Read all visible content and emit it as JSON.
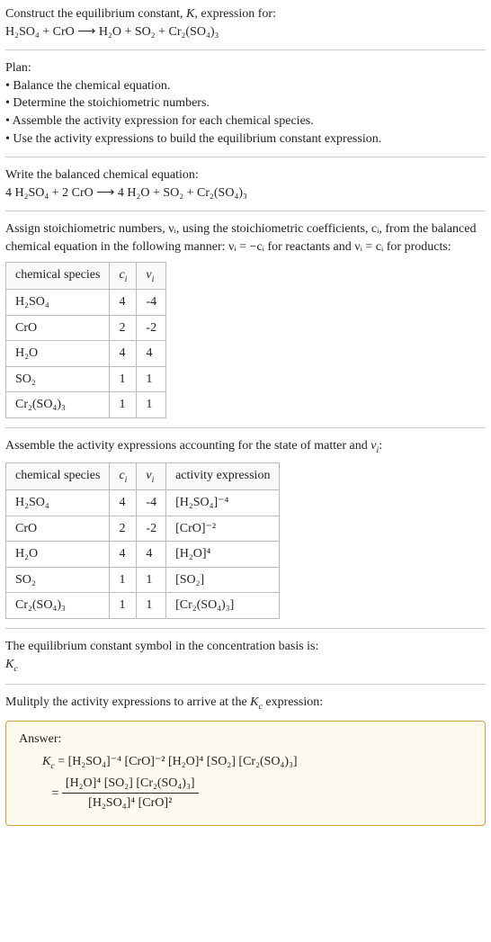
{
  "intro": {
    "line1": "Construct the equilibrium constant, K, expression for:",
    "eq_unbalanced": "H₂SO₄ + CrO ⟶ H₂O + SO₂ + Cr₂(SO₄)₃"
  },
  "plan": {
    "heading": "Plan:",
    "items": [
      "Balance the chemical equation.",
      "Determine the stoichiometric numbers.",
      "Assemble the activity expression for each chemical species.",
      "Use the activity expressions to build the equilibrium constant expression."
    ]
  },
  "balanced": {
    "heading": "Write the balanced chemical equation:",
    "eq": "4 H₂SO₄ + 2 CrO ⟶ 4 H₂O + SO₂ + Cr₂(SO₄)₃"
  },
  "stoich": {
    "text": "Assign stoichiometric numbers, νᵢ, using the stoichiometric coefficients, cᵢ, from the balanced chemical equation in the following manner: νᵢ = −cᵢ for reactants and νᵢ = cᵢ for products:",
    "headers": [
      "chemical species",
      "cᵢ",
      "νᵢ"
    ],
    "rows": [
      {
        "species": "H₂SO₄",
        "c": "4",
        "v": "-4"
      },
      {
        "species": "CrO",
        "c": "2",
        "v": "-2"
      },
      {
        "species": "H₂O",
        "c": "4",
        "v": "4"
      },
      {
        "species": "SO₂",
        "c": "1",
        "v": "1"
      },
      {
        "species": "Cr₂(SO₄)₃",
        "c": "1",
        "v": "1"
      }
    ]
  },
  "activity": {
    "text": "Assemble the activity expressions accounting for the state of matter and νᵢ:",
    "headers": [
      "chemical species",
      "cᵢ",
      "νᵢ",
      "activity expression"
    ],
    "rows": [
      {
        "species": "H₂SO₄",
        "c": "4",
        "v": "-4",
        "expr": "[H₂SO₄]⁻⁴"
      },
      {
        "species": "CrO",
        "c": "2",
        "v": "-2",
        "expr": "[CrO]⁻²"
      },
      {
        "species": "H₂O",
        "c": "4",
        "v": "4",
        "expr": "[H₂O]⁴"
      },
      {
        "species": "SO₂",
        "c": "1",
        "v": "1",
        "expr": "[SO₂]"
      },
      {
        "species": "Cr₂(SO₄)₃",
        "c": "1",
        "v": "1",
        "expr": "[Cr₂(SO₄)₃]"
      }
    ]
  },
  "symbol": {
    "text": "The equilibrium constant symbol in the concentration basis is:",
    "value": "K_c"
  },
  "multiply": {
    "text": "Mulitply the activity expressions to arrive at the K_c expression:"
  },
  "answer": {
    "label": "Answer:",
    "lhs": "K_c",
    "flat": "[H₂SO₄]⁻⁴ [CrO]⁻² [H₂O]⁴ [SO₂] [Cr₂(SO₄)₃]",
    "num": "[H₂O]⁴ [SO₂] [Cr₂(SO₄)₃]",
    "den": "[H₂SO₄]⁴ [CrO]²"
  },
  "chart_data": {
    "type": "table",
    "tables": [
      {
        "title": "Stoichiometric numbers",
        "columns": [
          "chemical species",
          "c_i",
          "ν_i"
        ],
        "rows": [
          [
            "H2SO4",
            4,
            -4
          ],
          [
            "CrO",
            2,
            -2
          ],
          [
            "H2O",
            4,
            4
          ],
          [
            "SO2",
            1,
            1
          ],
          [
            "Cr2(SO4)3",
            1,
            1
          ]
        ]
      },
      {
        "title": "Activity expressions",
        "columns": [
          "chemical species",
          "c_i",
          "ν_i",
          "activity expression"
        ],
        "rows": [
          [
            "H2SO4",
            4,
            -4,
            "[H2SO4]^-4"
          ],
          [
            "CrO",
            2,
            -2,
            "[CrO]^-2"
          ],
          [
            "H2O",
            4,
            4,
            "[H2O]^4"
          ],
          [
            "SO2",
            1,
            1,
            "[SO2]"
          ],
          [
            "Cr2(SO4)3",
            1,
            1,
            "[Cr2(SO4)3]"
          ]
        ]
      }
    ]
  }
}
